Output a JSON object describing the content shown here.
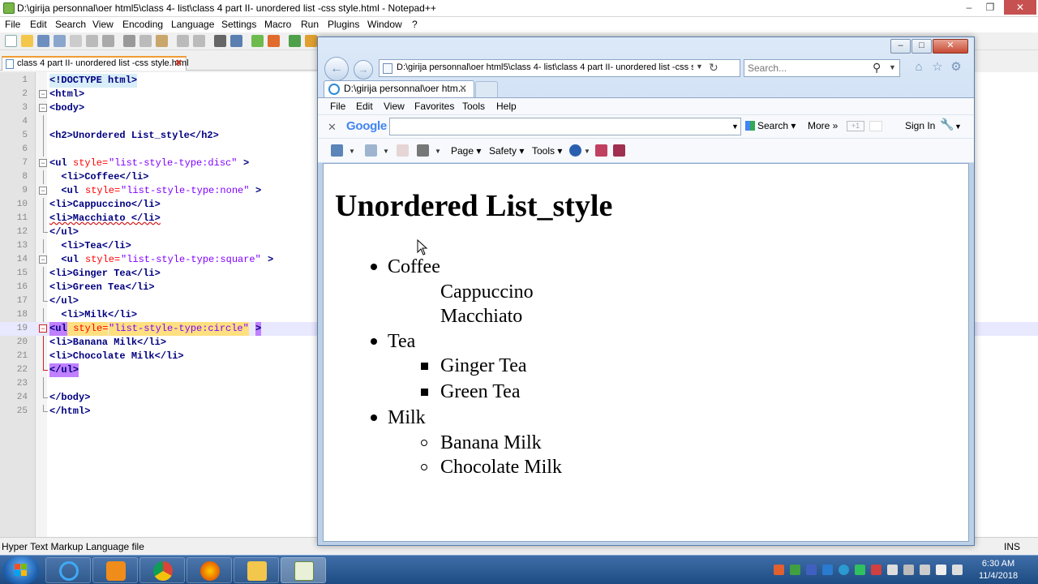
{
  "npp": {
    "title": "D:\\girija personnal\\oer html5\\class 4- list\\class 4  part II- unordered list -css style.html - Notepad++",
    "menu": [
      "File",
      "Edit",
      "Search",
      "View",
      "Encoding",
      "Language",
      "Settings",
      "Macro",
      "Run",
      "Plugins",
      "Window",
      "?"
    ],
    "tab": "class 4  part II- unordered list -css style.html",
    "lines": [
      {
        "n": "1",
        "code": "<!DOCTYPE html>"
      },
      {
        "n": "2",
        "code": "<html>"
      },
      {
        "n": "3",
        "code": "<body>"
      },
      {
        "n": "4",
        "code": ""
      },
      {
        "n": "5",
        "code": "<h2>Unordered List_style</h2>"
      },
      {
        "n": "6",
        "code": ""
      },
      {
        "n": "7",
        "tag": "<ul ",
        "attr": "style=",
        "val": "\"list-style-type:disc\"",
        "end": ">"
      },
      {
        "n": "8",
        "code": "  <li>Coffee</li>"
      },
      {
        "n": "9",
        "tag": "  <ul ",
        "attr": "style=",
        "val": "\"list-style-type:none\"",
        "end": ">"
      },
      {
        "n": "10",
        "code": "<li>Cappuccino</li>"
      },
      {
        "n": "11",
        "code": "<li>Macchiato </li>"
      },
      {
        "n": "12",
        "code": "</ul>"
      },
      {
        "n": "13",
        "code": "  <li>Tea</li>"
      },
      {
        "n": "14",
        "tag": "  <ul ",
        "attr": "style=",
        "val": "\"list-style-type:square\"",
        "end": ">"
      },
      {
        "n": "15",
        "code": "<li>Ginger Tea</li>"
      },
      {
        "n": "16",
        "code": "<li>Green Tea</li>"
      },
      {
        "n": "17",
        "code": "</ul>"
      },
      {
        "n": "18",
        "code": "  <li>Milk</li>"
      },
      {
        "n": "19",
        "tag": "<ul",
        "attr": " style=",
        "val": "\"list-style-type:circle\"",
        "end": ">"
      },
      {
        "n": "20",
        "code": "<li>Banana Milk</li>"
      },
      {
        "n": "21",
        "code": "<li>Chocolate Milk</li>"
      },
      {
        "n": "22",
        "code": "</ul>"
      },
      {
        "n": "23",
        "code": ""
      },
      {
        "n": "24",
        "code": "</body>"
      },
      {
        "n": "25",
        "code": "</html>"
      }
    ],
    "status": {
      "filetype": "Hyper Text Markup Language file",
      "mode": "INS"
    }
  },
  "ie": {
    "address": "D:\\girija personnal\\oer html5\\class 4- list\\class 4  part II- unordered list -css sty",
    "search_placeholder": "Search...",
    "tab_title": "D:\\girija personnal\\oer htm...",
    "menu": [
      "File",
      "Edit",
      "View",
      "Favorites",
      "Tools",
      "Help"
    ],
    "google": {
      "logo": "Google",
      "search_label": "Search",
      "more_label": "More",
      "signin_label": "Sign In"
    },
    "commands": {
      "page": "Page",
      "safety": "Safety",
      "tools": "Tools"
    },
    "page": {
      "heading": "Unordered List_style",
      "items": [
        {
          "text": "Coffee",
          "marker": "disc",
          "level": 1
        },
        {
          "text": "Cappuccino",
          "marker": "none",
          "level": 2
        },
        {
          "text": "Macchiato",
          "marker": "none",
          "level": 2
        },
        {
          "text": "Tea",
          "marker": "disc",
          "level": 1
        },
        {
          "text": "Ginger Tea",
          "marker": "square",
          "level": 2
        },
        {
          "text": "Green Tea",
          "marker": "square",
          "level": 2
        },
        {
          "text": "Milk",
          "marker": "disc",
          "level": 1
        },
        {
          "text": "Banana Milk",
          "marker": "circle",
          "level": 2
        },
        {
          "text": "Chocolate Milk",
          "marker": "circle",
          "level": 2
        }
      ]
    }
  },
  "taskbar": {
    "time": "6:30 AM",
    "date": "11/4/2018"
  }
}
